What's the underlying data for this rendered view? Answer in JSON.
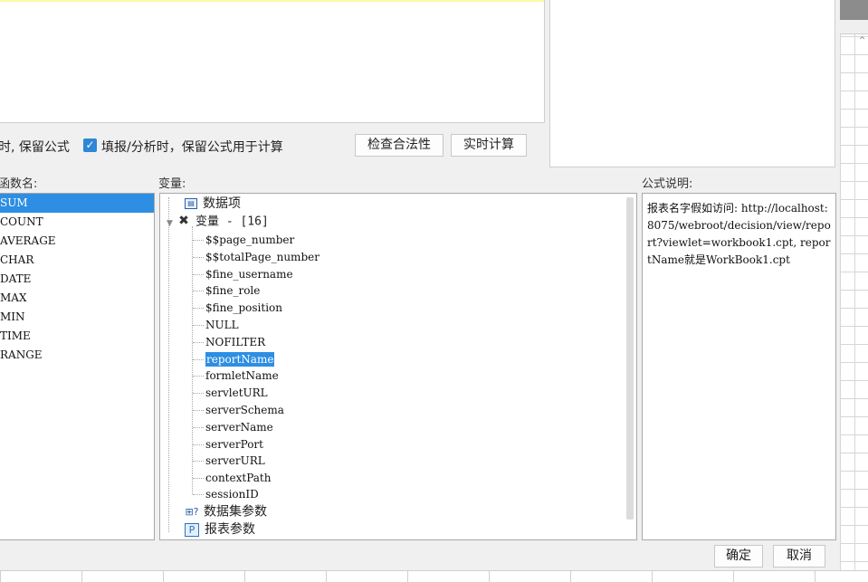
{
  "options": {
    "keep_formula_label": "时, 保留公式",
    "fill_analysis_label": "填报/分析时，保留公式用于计算",
    "fill_analysis_checked": true
  },
  "buttons": {
    "check_validity": "检查合法性",
    "realtime_calc": "实时计算",
    "ok": "确定",
    "cancel": "取消"
  },
  "labels": {
    "function_name": "函数名:",
    "variables": "变量:",
    "formula_description": "公式说明:"
  },
  "functions": [
    "SUM",
    "COUNT",
    "AVERAGE",
    "CHAR",
    "DATE",
    "MAX",
    "MIN",
    "TIME",
    "RANGE"
  ],
  "selected_function": "SUM",
  "tree": {
    "data_items": "数据项",
    "variables_group": "变量 - [16]",
    "variables": [
      "$$page_number",
      "$$totalPage_number",
      "$fine_username",
      "$fine_role",
      "$fine_position",
      "NULL",
      "NOFILTER",
      "reportName",
      "formletName",
      "servletURL",
      "serverSchema",
      "serverName",
      "serverPort",
      "serverURL",
      "contextPath",
      "sessionID"
    ],
    "selected_variable": "reportName",
    "dataset_params": "数据集参数",
    "report_params": "报表参数"
  },
  "description": {
    "text": "报表名字假如访问: http://localhost:8075/webroot/decision/view/report?viewlet=workbook1.cpt, reportName就是WorkBook1.cpt"
  },
  "icons": {
    "check": "check-icon",
    "data_item": "data-item-icon",
    "variables": "variables-icon",
    "dataset": "dataset-icon",
    "report_param": "report-param-icon",
    "expand": "chevron-down-icon"
  },
  "colors": {
    "selection": "#2d8ee3",
    "checkbox": "#2d87d6",
    "highlight": "#fdf9a8"
  }
}
